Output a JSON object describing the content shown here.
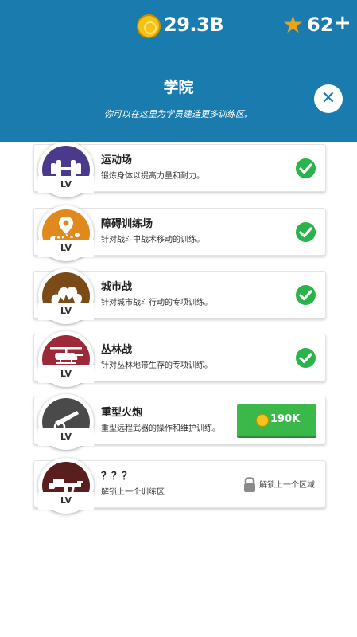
{
  "header": {
    "coins": "29.3B",
    "stars": "62",
    "plus": "+",
    "title": "学院",
    "subtitle": "你可以在这里为学员建造更多训练区。",
    "close": "✕",
    "colors": {
      "bar": "#1a7cae",
      "coin": "#f5c218",
      "star": "#e8a51a"
    }
  },
  "areas": [
    {
      "icon": "dumbbell-icon",
      "level": "LV",
      "name": "运动场",
      "desc": "锻炼身体以提高力量和耐力。",
      "status": "completed",
      "color": "#4b3a8c"
    },
    {
      "icon": "map-pin-icon",
      "level": "LV",
      "name": "障碍训练场",
      "desc": "针对战斗中战术移动的训练。",
      "status": "completed",
      "color": "#e08a1e"
    },
    {
      "icon": "explosion-icon",
      "level": "LV",
      "name": "城市战",
      "desc": "针对城市战斗行动的专项训练。",
      "status": "completed",
      "color": "#7a4a17"
    },
    {
      "icon": "helicopter-icon",
      "level": "LV",
      "name": "丛林战",
      "desc": "针对丛林地带生存的专项训练。",
      "status": "completed",
      "color": "#9c2838"
    },
    {
      "icon": "cannon-icon",
      "level": "LV",
      "name": "重型火炮",
      "desc": "重型远程武器的操作和维护训练。",
      "status": "buy",
      "price": "190K",
      "color": "#4a4a4a"
    },
    {
      "icon": "machine-gun-icon",
      "level": "LV",
      "name": "？？？",
      "desc": "解锁上一个训练区",
      "status": "locked",
      "lock_text": "解锁上一个区域",
      "color": "#5a1e1e"
    }
  ]
}
